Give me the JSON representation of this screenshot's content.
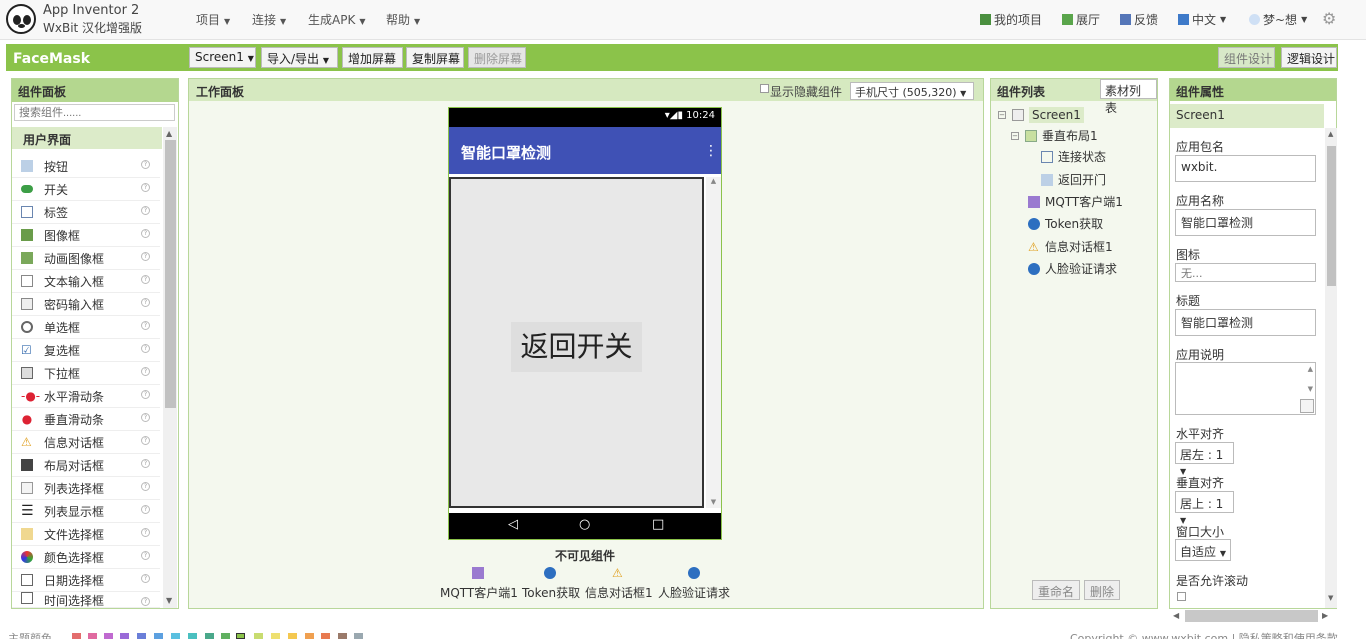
{
  "app": {
    "title_line1": "App Inventor 2",
    "title_line2": "WxBit 汉化增强版"
  },
  "topmenu": [
    "项目",
    "连接",
    "生成APK",
    "帮助"
  ],
  "rightmenu": {
    "my_projects": "我的项目",
    "gallery": "展厅",
    "feedback": "反馈",
    "language": "中文",
    "user": "梦~想"
  },
  "project": {
    "name": "FaceMask"
  },
  "toolbar": {
    "screen": "Screen1",
    "import_export": "导入/导出",
    "add_screen": "增加屏幕",
    "copy_screen": "复制屏幕",
    "delete_screen": "删除屏幕",
    "designer": "组件设计",
    "blocks": "逻辑设计"
  },
  "palette": {
    "title": "组件面板",
    "search_placeholder": "搜索组件......",
    "category": "用户界面",
    "items": [
      "按钮",
      "开关",
      "标签",
      "图像框",
      "动画图像框",
      "文本输入框",
      "密码输入框",
      "单选框",
      "复选框",
      "下拉框",
      "水平滑动条",
      "垂直滑动条",
      "信息对话框",
      "布局对话框",
      "列表选择框",
      "列表显示框",
      "文件选择框",
      "颜色选择框",
      "日期选择框",
      "时间选择框"
    ],
    "help": "?"
  },
  "viewer": {
    "title": "工作面板",
    "hidden_label": "显示隐藏组件",
    "size_select": "手机尺寸 (505,320)",
    "status_time": "10:24",
    "app_title": "智能口罩检测",
    "app_button": "返回开关",
    "nonvisible_title": "不可见组件",
    "nonvisible": [
      "MQTT客户端1",
      "Token获取",
      "信息对话框1",
      "人脸验证请求"
    ]
  },
  "tree": {
    "title": "组件列表",
    "assets_button": "素材列表",
    "screen": "Screen1",
    "arrangement": "垂直布局1",
    "children": [
      "连接状态",
      "返回开门"
    ],
    "others": [
      "MQTT客户端1",
      "Token获取",
      "信息对话框1",
      "人脸验证请求"
    ],
    "rename": "重命名",
    "delete": "删除"
  },
  "properties": {
    "title": "组件属性",
    "component": "Screen1",
    "package_label": "应用包名",
    "package_value": "wxbit.",
    "appname_label": "应用名称",
    "appname_value": "智能口罩检测",
    "icon_label": "图标",
    "icon_value": "无...",
    "title_label": "标题",
    "title_value": "智能口罩检测",
    "about_label": "应用说明",
    "halign_label": "水平对齐",
    "halign_value": "居左 : 1",
    "valign_label": "垂直对齐",
    "valign_value": "居上 : 1",
    "winsize_label": "窗口大小",
    "winsize_value": "自适应",
    "scroll_label": "是否允许滚动"
  },
  "footer": {
    "left": "主题颜色",
    "right": "Copyright © www.wxbit.com | 隐私策略和使用条款"
  },
  "colors": {
    "green": "#8bc34a",
    "app_bar": "#3f51b5",
    "panel_head": "#b4d78f"
  }
}
